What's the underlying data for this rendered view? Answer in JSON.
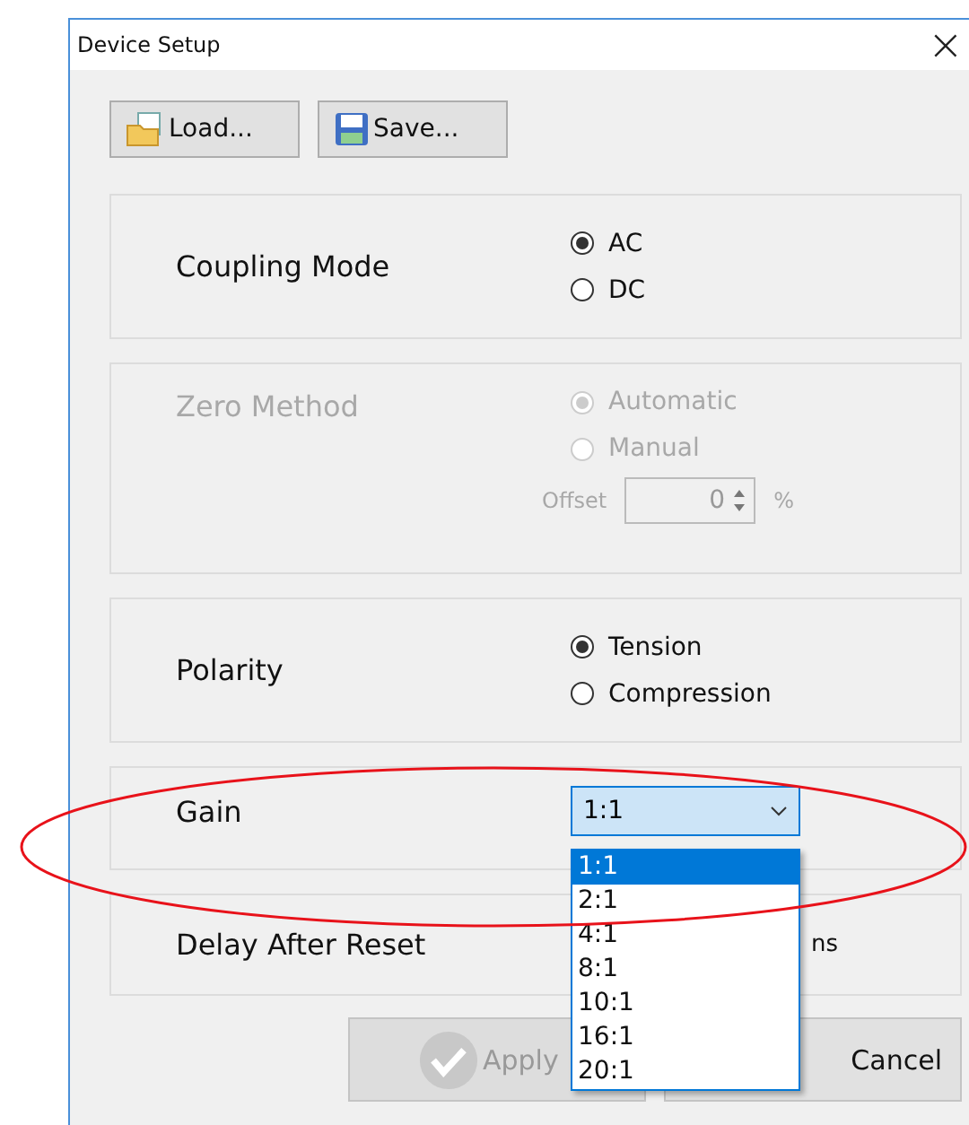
{
  "window": {
    "title": "Device Setup",
    "close": "×"
  },
  "toolbar": [
    {
      "label": "Load...",
      "kind": "load"
    },
    {
      "label": "Save...",
      "kind": "save"
    }
  ],
  "sections": [
    {
      "kind": "radio",
      "label": "Coupling Mode",
      "disabled": false,
      "options": [
        {
          "label": "AC",
          "selected": true
        },
        {
          "label": "DC",
          "selected": false
        }
      ]
    },
    {
      "kind": "radio",
      "label": "Zero Method",
      "disabled": true,
      "options": [
        {
          "label": "Automatic",
          "selected": true
        },
        {
          "label": "Manual",
          "selected": false
        }
      ],
      "offset": {
        "label": "Offset",
        "value": "0",
        "unit": "%"
      }
    },
    {
      "kind": "radio",
      "label": "Polarity",
      "disabled": false,
      "options": [
        {
          "label": "Tension",
          "selected": true
        },
        {
          "label": "Compression",
          "selected": false
        }
      ]
    },
    {
      "kind": "combo",
      "label": "Gain",
      "value": "1:1",
      "expanded": true,
      "options": [
        {
          "label": "1:1",
          "selected": true
        },
        {
          "label": "2:1",
          "selected": false
        },
        {
          "label": "4:1",
          "selected": false
        },
        {
          "label": "8:1",
          "selected": false
        },
        {
          "label": "10:1",
          "selected": false
        },
        {
          "label": "16:1",
          "selected": false
        },
        {
          "label": "20:1",
          "selected": false
        }
      ]
    },
    {
      "kind": "text",
      "label": "Delay After Reset",
      "unit": "ns"
    }
  ],
  "buttons": [
    {
      "label": "Apply",
      "disabled": true
    },
    {
      "label": "Cancel",
      "disabled": false
    }
  ],
  "annotation": {
    "kind": "ellipse",
    "color": "#e8121a"
  }
}
